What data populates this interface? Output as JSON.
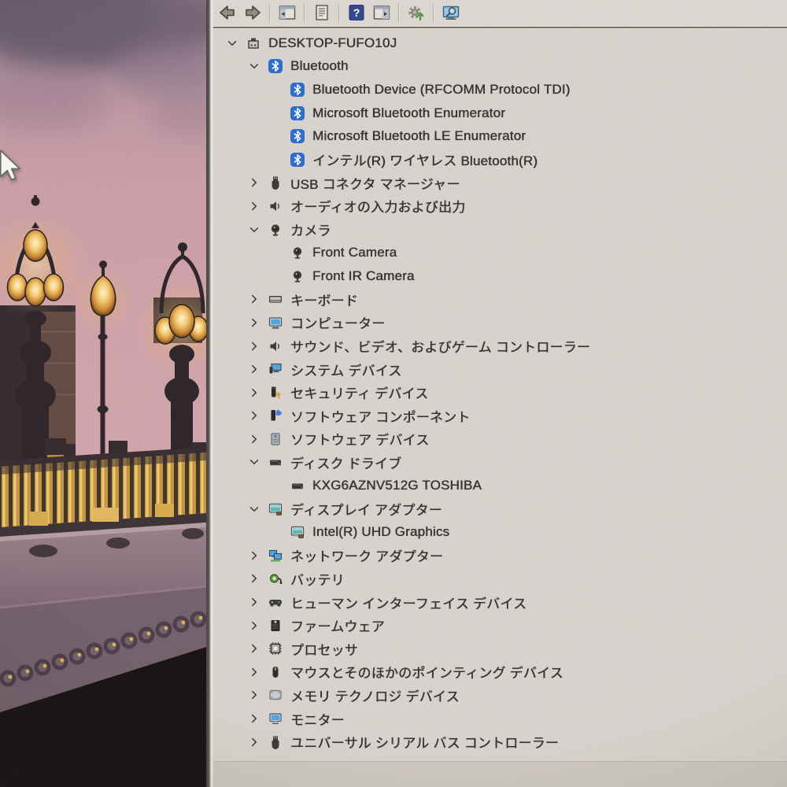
{
  "window": {
    "app": "device-manager",
    "toolbar": {
      "icons": [
        "back",
        "forward",
        "show-console-tree",
        "export-list",
        "help",
        "show-action-pane",
        "update-driver",
        "scan-hardware-changes"
      ]
    },
    "tree": {
      "items": [
        {
          "label": "DESKTOP-FUFO10J",
          "level": 0,
          "state": "expanded",
          "icon": "computer"
        },
        {
          "label": "Bluetooth",
          "level": 1,
          "state": "expanded",
          "icon": "bluetooth"
        },
        {
          "label": "Bluetooth Device (RFCOMM Protocol TDI)",
          "level": 2,
          "state": "leaf",
          "icon": "bluetooth"
        },
        {
          "label": "Microsoft Bluetooth Enumerator",
          "level": 2,
          "state": "leaf",
          "icon": "bluetooth"
        },
        {
          "label": "Microsoft Bluetooth LE Enumerator",
          "level": 2,
          "state": "leaf",
          "icon": "bluetooth"
        },
        {
          "label": "インテル(R) ワイヤレス Bluetooth(R)",
          "level": 2,
          "state": "leaf",
          "icon": "bluetooth"
        },
        {
          "label": "USB コネクタ マネージャー",
          "level": 1,
          "state": "collapsed",
          "icon": "usb"
        },
        {
          "label": "オーディオの入力および出力",
          "level": 1,
          "state": "collapsed",
          "icon": "audio"
        },
        {
          "label": "カメラ",
          "level": 1,
          "state": "expanded",
          "icon": "camera"
        },
        {
          "label": "Front Camera",
          "level": 2,
          "state": "leaf",
          "icon": "camera"
        },
        {
          "label": "Front IR Camera",
          "level": 2,
          "state": "leaf",
          "icon": "camera"
        },
        {
          "label": "キーボード",
          "level": 1,
          "state": "collapsed",
          "icon": "keyboard"
        },
        {
          "label": "コンピューター",
          "level": 1,
          "state": "collapsed",
          "icon": "computer-blue"
        },
        {
          "label": "サウンド、ビデオ、およびゲーム コントローラー",
          "level": 1,
          "state": "collapsed",
          "icon": "audio"
        },
        {
          "label": "システム デバイス",
          "level": 1,
          "state": "collapsed",
          "icon": "system-devices"
        },
        {
          "label": "セキュリティ デバイス",
          "level": 1,
          "state": "collapsed",
          "icon": "security"
        },
        {
          "label": "ソフトウェア コンポーネント",
          "level": 1,
          "state": "collapsed",
          "icon": "software-component"
        },
        {
          "label": "ソフトウェア デバイス",
          "level": 1,
          "state": "collapsed",
          "icon": "software-device"
        },
        {
          "label": "ディスク ドライブ",
          "level": 1,
          "state": "expanded",
          "icon": "disk"
        },
        {
          "label": "KXG6AZNV512G TOSHIBA",
          "level": 2,
          "state": "leaf",
          "icon": "disk"
        },
        {
          "label": "ディスプレイ アダプター",
          "level": 1,
          "state": "expanded",
          "icon": "display"
        },
        {
          "label": "Intel(R) UHD Graphics",
          "level": 2,
          "state": "leaf",
          "icon": "display"
        },
        {
          "label": "ネットワーク アダプター",
          "level": 1,
          "state": "collapsed",
          "icon": "network"
        },
        {
          "label": "バッテリ",
          "level": 1,
          "state": "collapsed",
          "icon": "battery"
        },
        {
          "label": "ヒューマン インターフェイス デバイス",
          "level": 1,
          "state": "collapsed",
          "icon": "hid"
        },
        {
          "label": "ファームウェア",
          "level": 1,
          "state": "collapsed",
          "icon": "firmware"
        },
        {
          "label": "プロセッサ",
          "level": 1,
          "state": "collapsed",
          "icon": "processor"
        },
        {
          "label": "マウスとそのほかのポインティング デバイス",
          "level": 1,
          "state": "collapsed",
          "icon": "mouse"
        },
        {
          "label": "メモリ テクノロジ デバイス",
          "level": 1,
          "state": "collapsed",
          "icon": "memory"
        },
        {
          "label": "モニター",
          "level": 1,
          "state": "collapsed",
          "icon": "monitor"
        },
        {
          "label": "ユニバーサル シリアル バス コントローラー",
          "level": 1,
          "state": "collapsed",
          "icon": "usb"
        }
      ]
    }
  },
  "colors": {
    "window_bg": "#d8d4cd",
    "toolbar_bg": "#dcd8d1",
    "text": "#2a2526",
    "bluetooth_blue": "#2268cc",
    "help_blue": "#2a3f8f",
    "sky_pink": "#cb9da6",
    "lamp_gold": "#e8b34a"
  }
}
